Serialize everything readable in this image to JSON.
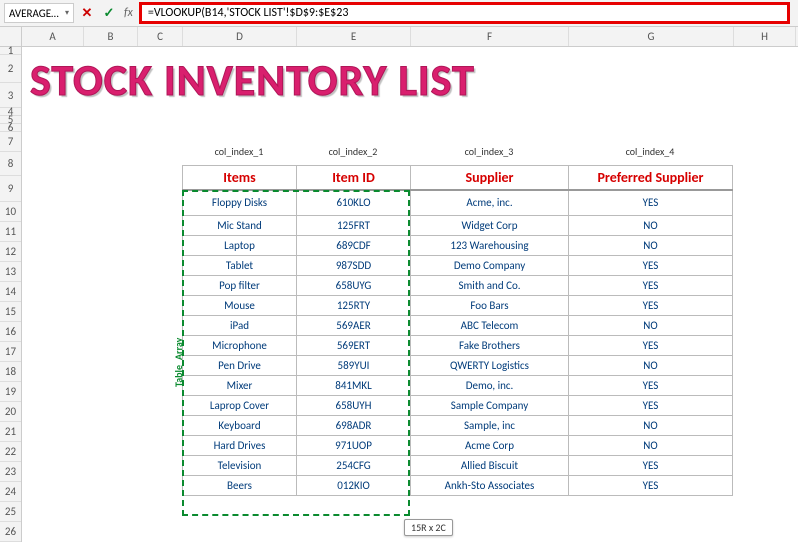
{
  "formula_bar": {
    "namebox": "AVERAGE…",
    "formula": "=VLOOKUP(B14,'STOCK LIST'!$D$9:$E$23"
  },
  "columns": [
    "A",
    "B",
    "C",
    "D",
    "E",
    "F",
    "G",
    "H"
  ],
  "rows": [
    "1",
    "2",
    "3",
    "4",
    "5",
    "6",
    "7",
    "8",
    "9",
    "10",
    "11",
    "12",
    "13",
    "14",
    "15",
    "16",
    "17",
    "18",
    "19",
    "20",
    "21",
    "22",
    "23",
    "24",
    "25",
    "26"
  ],
  "title": "STOCK INVENTORY LIST",
  "col_index_labels": [
    "col_index_1",
    "col_index_2",
    "col_index_3",
    "col_index_4"
  ],
  "table": {
    "headers": [
      "Items",
      "Item ID",
      "Supplier",
      "Preferred Supplier"
    ],
    "rows": [
      [
        "Floppy Disks",
        "610KLO",
        "Acme, inc.",
        "YES"
      ],
      [
        "Mic Stand",
        "125FRT",
        "Widget Corp",
        "NO"
      ],
      [
        "Laptop",
        "689CDF",
        "123 Warehousing",
        "NO"
      ],
      [
        "Tablet",
        "987SDD",
        "Demo Company",
        "YES"
      ],
      [
        "Pop filter",
        "658UYG",
        "Smith and Co.",
        "YES"
      ],
      [
        "Mouse",
        "125RTY",
        "Foo Bars",
        "YES"
      ],
      [
        "iPad",
        "569AER",
        "ABC Telecom",
        "NO"
      ],
      [
        "Microphone",
        "569ERT",
        "Fake Brothers",
        "YES"
      ],
      [
        "Pen Drive",
        "589YUI",
        "QWERTY Logistics",
        "NO"
      ],
      [
        "Mixer",
        "841MKL",
        "Demo, inc.",
        "YES"
      ],
      [
        "Laprop Cover",
        "658UYH",
        "Sample Company",
        "YES"
      ],
      [
        "Keyboard",
        "698ADR",
        "Sample, inc",
        "NO"
      ],
      [
        "Hard Drives",
        "971UOP",
        "Acme Corp",
        "NO"
      ],
      [
        "Television",
        "254CFG",
        "Allied Biscuit",
        "YES"
      ],
      [
        "Beers",
        "012KIO",
        "Ankh-Sto Associates",
        "YES"
      ]
    ]
  },
  "side_label": "Table_Array",
  "selection_badge": "15R x 2C"
}
